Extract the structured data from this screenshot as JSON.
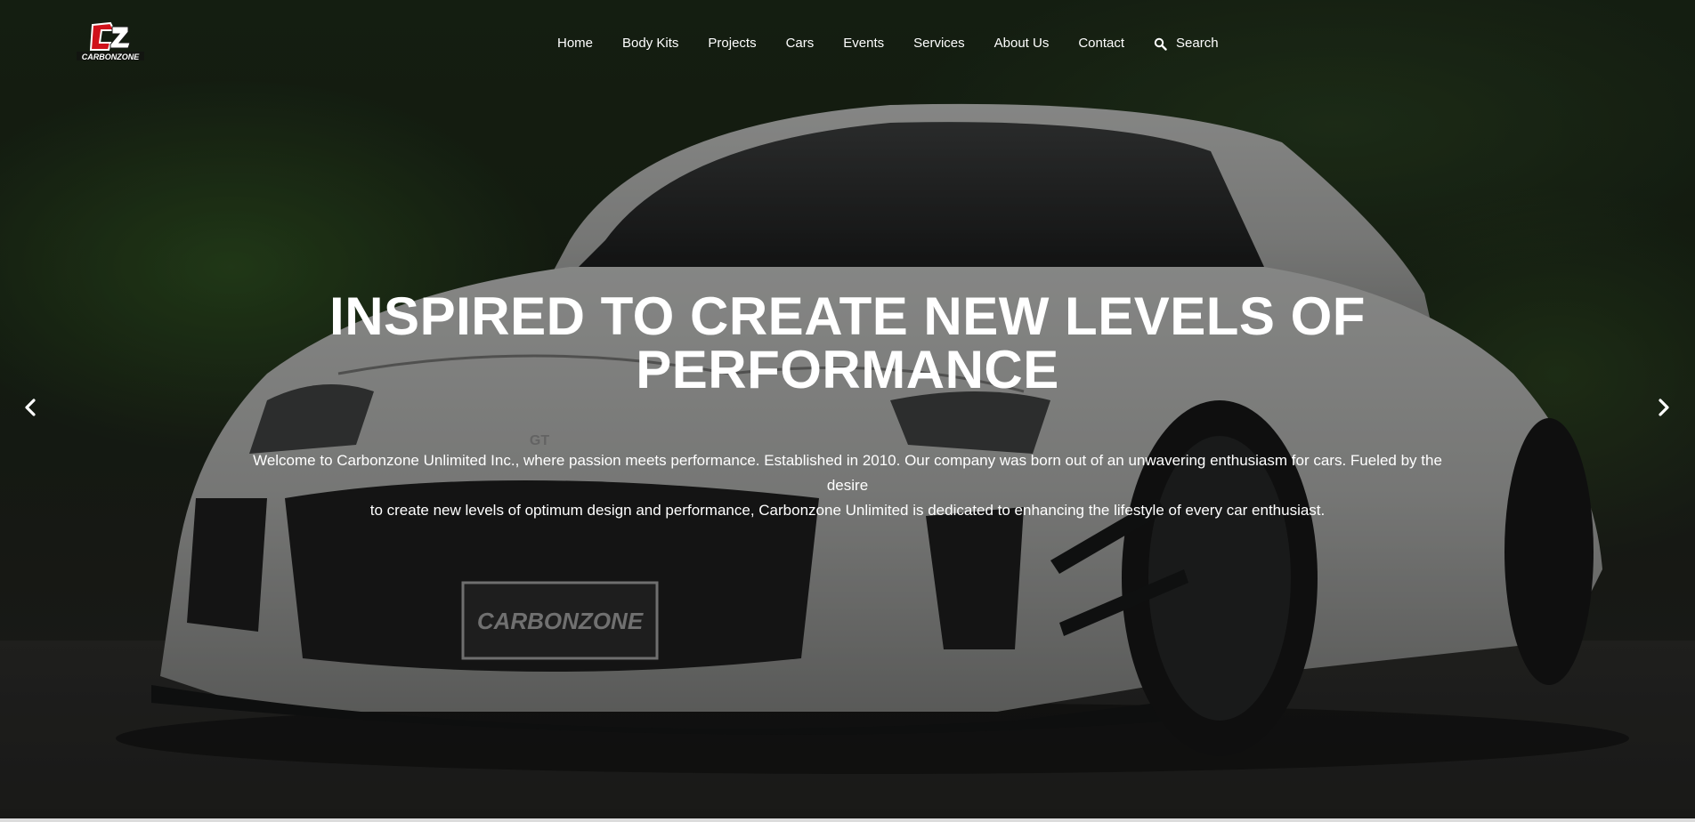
{
  "brand": {
    "logo_text": "CARBONZONE",
    "logo_icon": "cz-logo",
    "accent_color": "#d0121b"
  },
  "nav": {
    "items": [
      {
        "label": "Home"
      },
      {
        "label": "Body Kits"
      },
      {
        "label": "Projects"
      },
      {
        "label": "Cars"
      },
      {
        "label": "Events"
      },
      {
        "label": "Services"
      },
      {
        "label": "About Us"
      },
      {
        "label": "Contact"
      }
    ],
    "search_label": "Search",
    "search_icon": "search-icon"
  },
  "hero": {
    "headline_line1": "INSPIRED TO CREATE NEW LEVELS OF",
    "headline_line2": "PERFORMANCE",
    "intro_line1": "Welcome to Carbonzone Unlimited Inc., where passion meets performance. Established in 2010. Our company was born out of an unwavering enthusiasm for cars. Fueled by the desire",
    "intro_line2": "to create new levels of optimum design and performance, Carbonzone Unlimited is dedicated to enhancing the lifestyle of every car enthusiast.",
    "plate_text": "CARBONZONE",
    "badge_text": "GT",
    "prev_icon": "chevron-left-icon",
    "next_icon": "chevron-right-icon"
  }
}
